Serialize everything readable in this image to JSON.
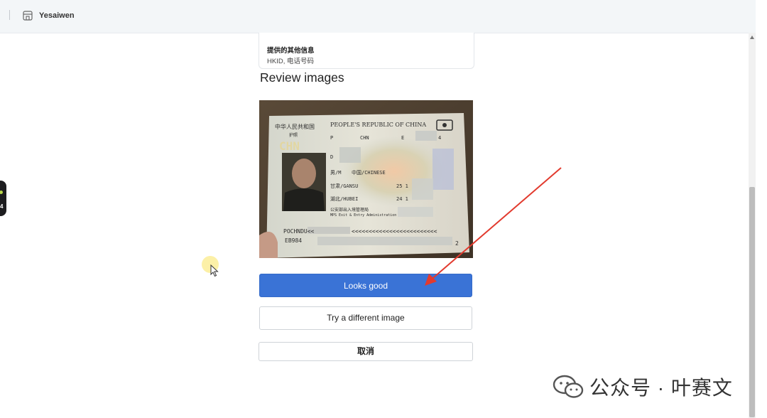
{
  "header": {
    "app_title": "Yesaiwen"
  },
  "info_card": {
    "title": "提供的其他信息",
    "detail": "HKID, 电话号码"
  },
  "review": {
    "heading": "Review images"
  },
  "passport": {
    "country_cn": "中华人民共和国",
    "country_en": "PEOPLE'S REPUBLIC OF CHINA",
    "doc_type_cn": "护照",
    "type": "P",
    "country_code": "CHN",
    "passport_no_prefix": "E",
    "passport_no_suffix": "4",
    "watermark_code": "CHN",
    "sex": "男/M",
    "nationality": "中国/CHINESE",
    "birthplace": "甘肃/GANSU",
    "issue_place": "湖北/HUBEI",
    "birth_date_partial": "25 1",
    "issue_date_partial": "24 1",
    "authority_cn": "公安部出入境管理局",
    "authority_en": "MPS Exit & Entry Administration",
    "name_initial": "D",
    "mrz_line1": "POCHNDU<<",
    "mrz_line1_fill": "<<<<<<<<<<<<<<<<<<<<<<<<<",
    "mrz_line2": "EB984",
    "mrz_line2_end": "2"
  },
  "buttons": {
    "looks_good": "Looks good",
    "try_different": "Try a different image",
    "cancel": "取消"
  },
  "left_widget": {
    "text": "4"
  },
  "watermark": {
    "text": "公众号 · 叶赛文"
  },
  "colors": {
    "primary": "#3a73d6",
    "annotation_arrow": "#e23a2e"
  }
}
